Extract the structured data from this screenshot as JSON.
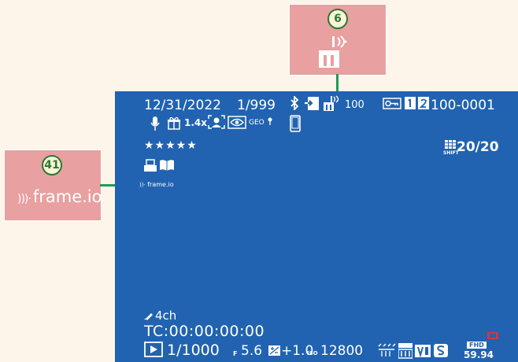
{
  "callouts": [
    {
      "number": "6"
    },
    {
      "number": "41",
      "label": "frame.io"
    }
  ],
  "screen": {
    "date": "12/31/2022",
    "frame_counter": "1/999",
    "transfer_number": "100",
    "file_number": "100-0001",
    "wifi_label": "GEO",
    "bracket_label": "1.4x",
    "rating": "★★★★★",
    "shots": "20/20",
    "shift_label": "SHIFT",
    "frameio_tag": "frame.io",
    "audio": "4ch",
    "timecode": "TC:00:00:00:00",
    "shutter": "1/1000",
    "aperture_prefix": "F",
    "aperture": "5.6",
    "ev": "+1.0",
    "iso_prefix": "ISO",
    "iso": "12800",
    "fhd": "FHD",
    "fps": "59.94"
  },
  "colors": {
    "background": "#fdf5ea",
    "screen": "#2163b0",
    "callout": "#e8a0a0",
    "leader": "#1f9a55"
  }
}
